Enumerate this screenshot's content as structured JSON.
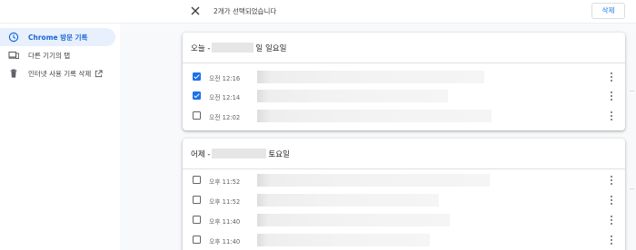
{
  "toolbar": {
    "selection_text": "2개가 선택되었습니다",
    "delete_label": "삭제",
    "close_icon": "close-icon"
  },
  "sidebar": {
    "items": [
      {
        "label": "Chrome 방문 기록",
        "icon": "clock-icon",
        "active": true
      },
      {
        "label": "다른 기기의 탭",
        "icon": "devices-icon",
        "active": false
      },
      {
        "label": "인터넷 사용 기록 삭제",
        "icon": "trash-icon",
        "active": false,
        "trailing_icon": "open-in-new-icon"
      }
    ]
  },
  "cards": [
    {
      "title_prefix": "오늘 -",
      "title_suffix": "일 일요일",
      "rows": [
        {
          "time": "오전 12:16",
          "checked": true
        },
        {
          "time": "오전 12:14",
          "checked": true
        },
        {
          "time": "오전 12:02",
          "checked": false
        }
      ]
    },
    {
      "title_prefix": "어제 -",
      "title_suffix": "토요일",
      "rows": [
        {
          "time": "오후 11:52",
          "checked": false
        },
        {
          "time": "오후 11:52",
          "checked": false
        },
        {
          "time": "오후 11:40",
          "checked": false
        },
        {
          "time": "오후 11:40",
          "checked": false
        }
      ]
    }
  ],
  "colors": {
    "accent": "#1a73e8",
    "active_bg": "#e8f0fe",
    "active_text": "#1967d2"
  }
}
